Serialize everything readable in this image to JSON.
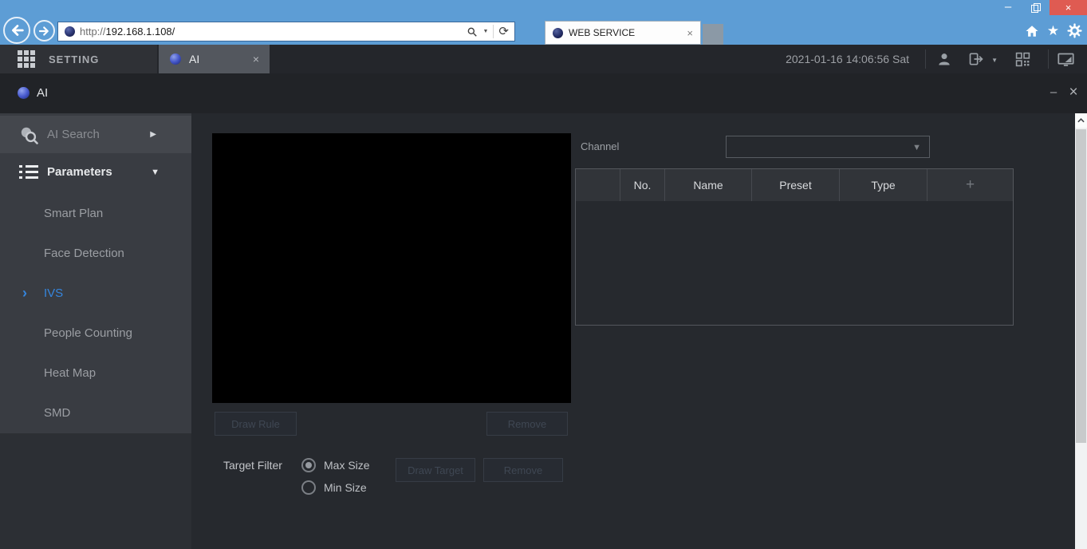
{
  "colors": {
    "chrome_blue": "#5d9dd5",
    "close_red": "#df5b52",
    "accent_blue": "#3585dd",
    "dark_bg": "#26292e",
    "sidebar_bg": "#393c42"
  },
  "icons": {
    "close_glyph": "×",
    "minimize_glyph": "–",
    "star_glyph": "★",
    "refresh_glyph": "⟳",
    "caret_down_glyph": "▼",
    "arrow_right_glyph": "▶",
    "ivs_arrow_glyph": "›"
  },
  "browser": {
    "url_prefix": "http://",
    "url_host": "192.168.1.108/",
    "tab_title": "WEB SERVICE"
  },
  "app_bar": {
    "setting_label": "SETTING",
    "ai_tab_label": "AI",
    "datetime": "2021-01-16 14:06:56 Sat"
  },
  "ai_window": {
    "title": "AI"
  },
  "sidebar": {
    "ai_search_label": "AI Search",
    "parameters_label": "Parameters",
    "items": [
      {
        "label": "Smart Plan",
        "active": false
      },
      {
        "label": "Face Detection",
        "active": false
      },
      {
        "label": "IVS",
        "active": true
      },
      {
        "label": "People Counting",
        "active": false
      },
      {
        "label": "Heat Map",
        "active": false
      },
      {
        "label": "SMD",
        "active": false
      }
    ]
  },
  "main": {
    "channel_label": "Channel",
    "channel_value": "",
    "table": {
      "headers": [
        "",
        "No.",
        "Name",
        "Preset",
        "Type",
        "+"
      ]
    },
    "buttons": {
      "draw_rule": "Draw Rule",
      "remove_rule": "Remove",
      "draw_target": "Draw Target",
      "remove_target": "Remove",
      "disabled": true
    },
    "target_filter": {
      "label": "Target Filter",
      "options": [
        {
          "label": "Max Size",
          "selected": true
        },
        {
          "label": "Min Size",
          "selected": false
        }
      ]
    }
  }
}
